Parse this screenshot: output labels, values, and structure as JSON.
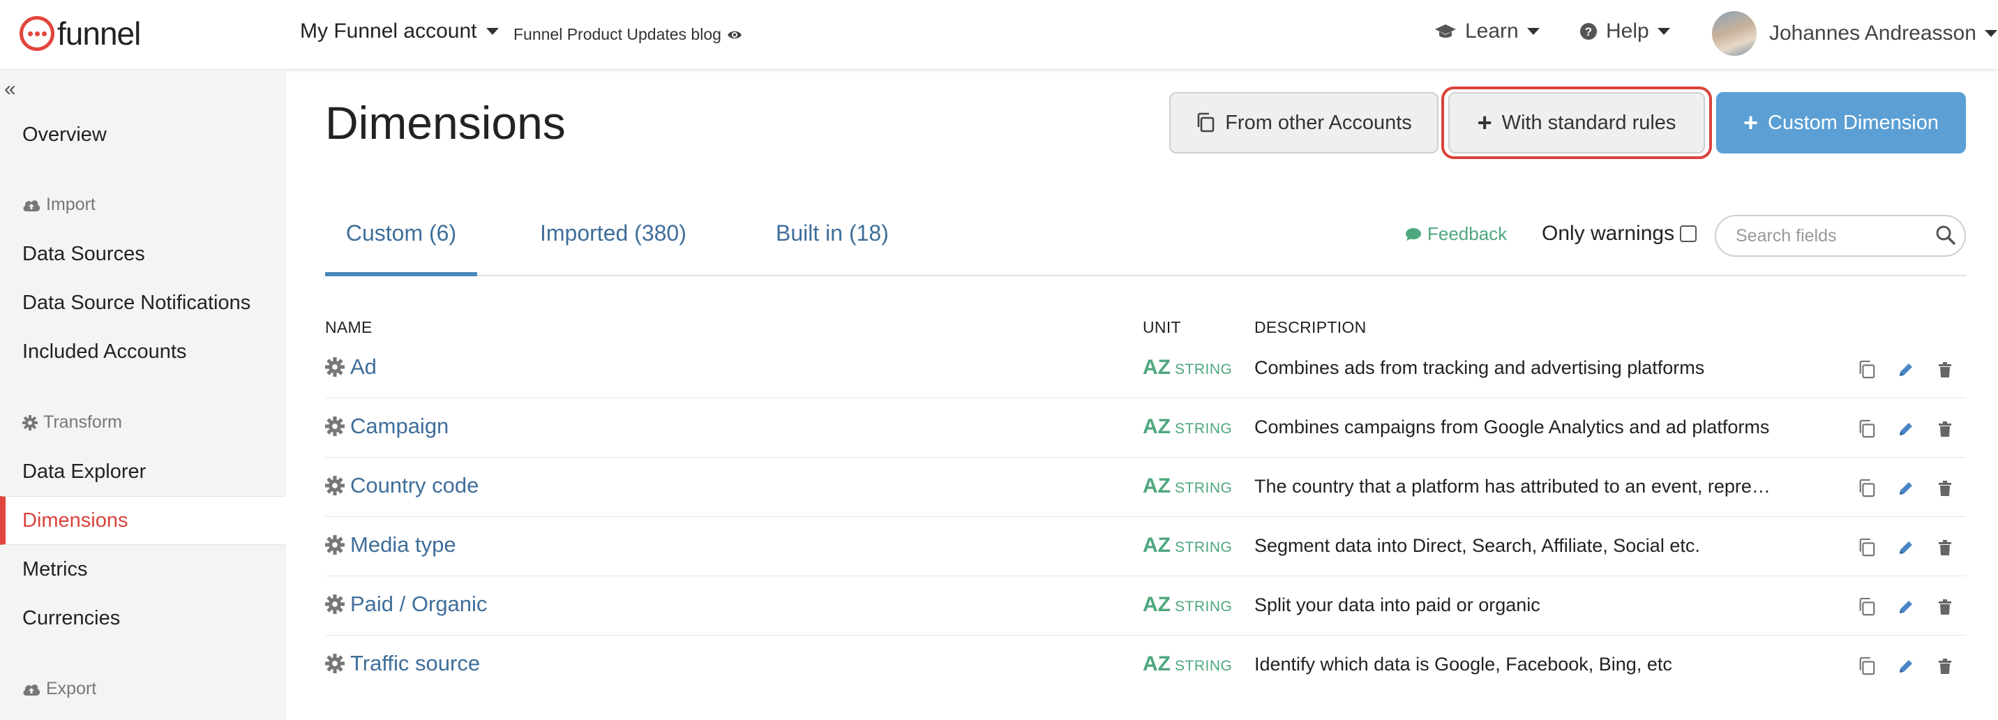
{
  "header": {
    "logo_text": "funnel",
    "account_label": "My Funnel account",
    "blog_link": "Funnel Product Updates blog",
    "learn_label": "Learn",
    "help_label": "Help",
    "user_name": "Johannes Andreasson"
  },
  "sidebar": {
    "overview": "Overview",
    "import_heading": "Import",
    "data_sources": "Data Sources",
    "data_source_notifications": "Data Source Notifications",
    "included_accounts": "Included Accounts",
    "transform_heading": "Transform",
    "data_explorer": "Data Explorer",
    "dimensions": "Dimensions",
    "metrics": "Metrics",
    "currencies": "Currencies",
    "export_heading": "Export",
    "active_item": "Dimensions"
  },
  "main": {
    "page_title": "Dimensions",
    "btn_other_accounts": "From other Accounts",
    "btn_standard_rules": "With standard rules",
    "btn_custom_dimension": "Custom Dimension",
    "tabs": [
      {
        "label": "Custom (6)",
        "active": true
      },
      {
        "label": "Imported (380)",
        "active": false
      },
      {
        "label": "Built in (18)",
        "active": false
      }
    ],
    "feedback_label": "Feedback",
    "only_warnings_label": "Only warnings",
    "only_warnings_checked": false,
    "search_placeholder": "Search fields"
  },
  "table": {
    "columns": {
      "name": "NAME",
      "unit": "UNIT",
      "description": "DESCRIPTION"
    },
    "rows": [
      {
        "name": "Ad",
        "unit_badge": "AZ",
        "unit_type": "STRING",
        "description": "Combines ads from tracking and advertising platforms"
      },
      {
        "name": "Campaign",
        "unit_badge": "AZ",
        "unit_type": "STRING",
        "description": "Combines campaigns from Google Analytics and ad platforms"
      },
      {
        "name": "Country code",
        "unit_badge": "AZ",
        "unit_type": "STRING",
        "description": "The country that a platform has attributed to an event, represented b..."
      },
      {
        "name": "Media type",
        "unit_badge": "AZ",
        "unit_type": "STRING",
        "description": "Segment data into Direct, Search, Affiliate, Social etc."
      },
      {
        "name": "Paid / Organic",
        "unit_badge": "AZ",
        "unit_type": "STRING",
        "description": "Split your data into paid or organic"
      },
      {
        "name": "Traffic source",
        "unit_badge": "AZ",
        "unit_type": "STRING",
        "description": "Identify which data is Google, Facebook, Bing, etc"
      }
    ]
  },
  "colors": {
    "brand": "#e2453c",
    "link": "#3f6e9a",
    "primary_button": "#5b9fd4",
    "string_unit": "#4ea77d",
    "highlight_ring": "#d9433b"
  },
  "icons": [
    "funnel-logo",
    "eye-icon",
    "graduation-cap-icon",
    "question-circle-icon",
    "collapse-icon",
    "cloud-upload-icon",
    "gear-icon",
    "copy-icon",
    "plus-icon",
    "comment-icon",
    "search-icon",
    "custom-gear-icon",
    "pencil-icon",
    "trash-icon"
  ]
}
